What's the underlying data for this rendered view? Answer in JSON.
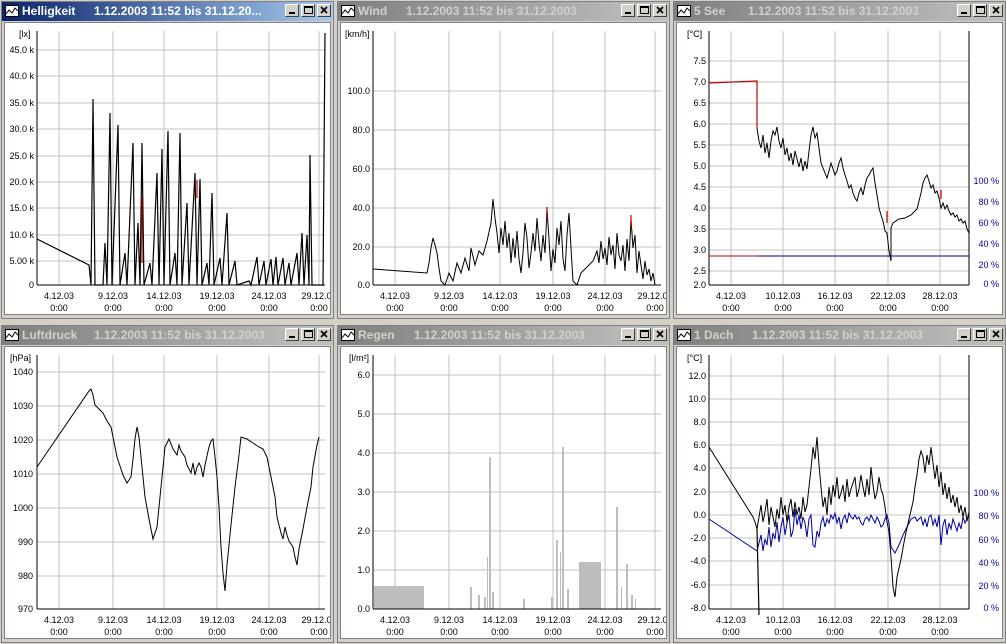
{
  "windows": [
    {
      "id": "helligkeit",
      "title": "Helligkeit",
      "range": "1.12.2003   11:52   bis   31.12.20...",
      "active": true,
      "unit": "[lx]",
      "yticks": [
        "45.0 k",
        "40.0 k",
        "35.0 k",
        "30.0 k",
        "25.0 k",
        "20.0 k",
        "15.0 k",
        "10.0 k",
        "5.00 k",
        "0"
      ],
      "xticks": [
        "4.12.03",
        "9.12.03",
        "14.12.03",
        "19.12.03",
        "24.12.03",
        "29.12.03"
      ],
      "xsub": "0:00"
    },
    {
      "id": "wind",
      "title": "Wind",
      "range": "1.12.2003   11:52   bis   31.12.2003",
      "active": false,
      "unit": "[km/h]",
      "yticks": [
        "100.0",
        "80.0",
        "60.0",
        "40.0",
        "20.0",
        "0.0"
      ],
      "xticks": [
        "4.12.03",
        "9.12.03",
        "14.12.03",
        "19.12.03",
        "24.12.03",
        "29.12.03"
      ],
      "xsub": "0:00"
    },
    {
      "id": "see",
      "title": "5 See",
      "range": "1.12.2003   11:52   bis   31.12.2003",
      "active": false,
      "unit": "[°C]",
      "yticks": [
        "7.5",
        "7.0",
        "6.5",
        "6.0",
        "5.5",
        "5.0",
        "4.5",
        "4.0",
        "3.5",
        "3.0",
        "2.5",
        "2.0"
      ],
      "ryticks": [
        "100 %",
        "80 %",
        "60 %",
        "40 %",
        "20 %",
        "0 %"
      ],
      "xticks": [
        "4.12.03",
        "10.12.03",
        "16.12.03",
        "22.12.03",
        "28.12.03"
      ],
      "xsub": "0:00"
    },
    {
      "id": "luftdruck",
      "title": "Luftdruck",
      "range": "1.12.2003   11:52   bis   31.12.2003",
      "active": false,
      "unit": "[hPa]",
      "yticks": [
        "1040",
        "1030",
        "1020",
        "1010",
        "1000",
        "990",
        "980",
        "970"
      ],
      "xticks": [
        "4.12.03",
        "9.12.03",
        "14.12.03",
        "19.12.03",
        "24.12.03",
        "29.12.03"
      ],
      "xsub": "0:00"
    },
    {
      "id": "regen",
      "title": "Regen",
      "range": "1.12.2003   11:52   bis   31.12.2003",
      "active": false,
      "unit": "[l/m²]",
      "yticks": [
        "6.0",
        "5.0",
        "4.0",
        "3.0",
        "2.0",
        "1.0",
        "0.0"
      ],
      "xticks": [
        "4.12.03",
        "9.12.03",
        "14.12.03",
        "19.12.03",
        "24.12.03",
        "29.12.03"
      ],
      "xsub": "0:00"
    },
    {
      "id": "dach",
      "title": "1 Dach",
      "range": "1.12.2003   11:52   bis   31.12.2003",
      "active": false,
      "unit": "[°C]",
      "yticks": [
        "12.0",
        "10.0",
        "8.0",
        "6.0",
        "4.0",
        "2.0",
        "0.0",
        "-2.0",
        "-4.0",
        "-6.0",
        "-8.0"
      ],
      "ryticks": [
        "100 %",
        "80 %",
        "60 %",
        "40 %",
        "20 %",
        "0 %"
      ],
      "xticks": [
        "4.12.03",
        "10.12.03",
        "16.12.03",
        "22.12.03",
        "28.12.03"
      ],
      "xsub": "0:00"
    }
  ],
  "colors": {
    "active_title": "#0a246a",
    "inactive_title": "#808080",
    "grid": "#c0c0c0",
    "line": "#000000",
    "humidity": "#0000a0",
    "highlight": "#c00000",
    "rain": "#bdbdbd"
  }
}
